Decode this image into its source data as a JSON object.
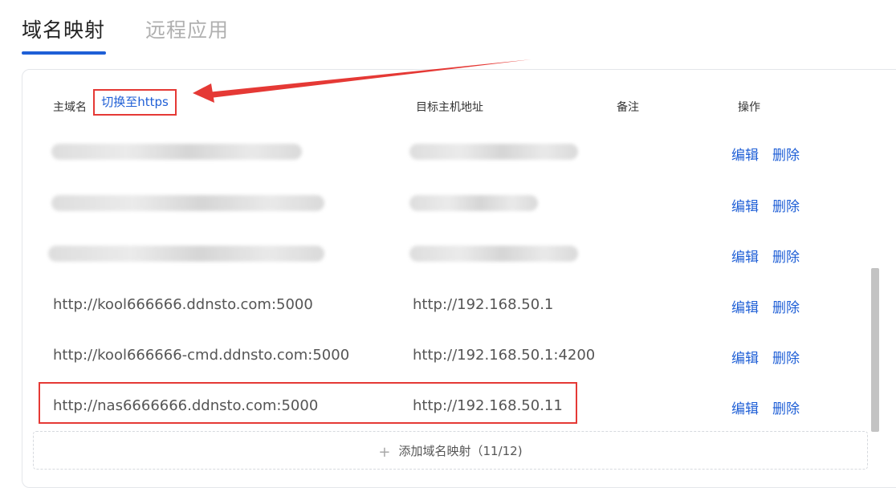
{
  "tabs": {
    "active": "域名映射",
    "inactive": "远程应用"
  },
  "table": {
    "headers": {
      "host": "主域名",
      "switch_link": "切换至https",
      "target": "目标主机地址",
      "note": "备注",
      "ops": "操作"
    },
    "rows": [
      {
        "host": "",
        "target": "",
        "note": "",
        "edit": "编辑",
        "delete": "删除",
        "blurred": true
      },
      {
        "host": "",
        "target": "",
        "note": "",
        "edit": "编辑",
        "delete": "删除",
        "blurred": true
      },
      {
        "host": "",
        "target": "",
        "note": "",
        "edit": "编辑",
        "delete": "删除",
        "blurred": true
      },
      {
        "host": "http://kool666666.ddnsto.com:5000",
        "target": "http://192.168.50.1",
        "note": "",
        "edit": "编辑",
        "delete": "删除"
      },
      {
        "host": "http://kool666666-cmd.ddnsto.com:5000",
        "target": "http://192.168.50.1:4200",
        "note": "",
        "edit": "编辑",
        "delete": "删除"
      },
      {
        "host": "http://nas6666666.ddnsto.com:5000",
        "target": "http://192.168.50.11",
        "note": "",
        "edit": "编辑",
        "delete": "删除",
        "highlighted": true
      }
    ]
  },
  "add_button": {
    "label": "添加域名映射（11/12)"
  },
  "colors": {
    "accent": "#1f5fd6",
    "annotation": "#e53935"
  },
  "icons": {
    "add": "plus-icon",
    "annotation": "arrow-annotation"
  }
}
